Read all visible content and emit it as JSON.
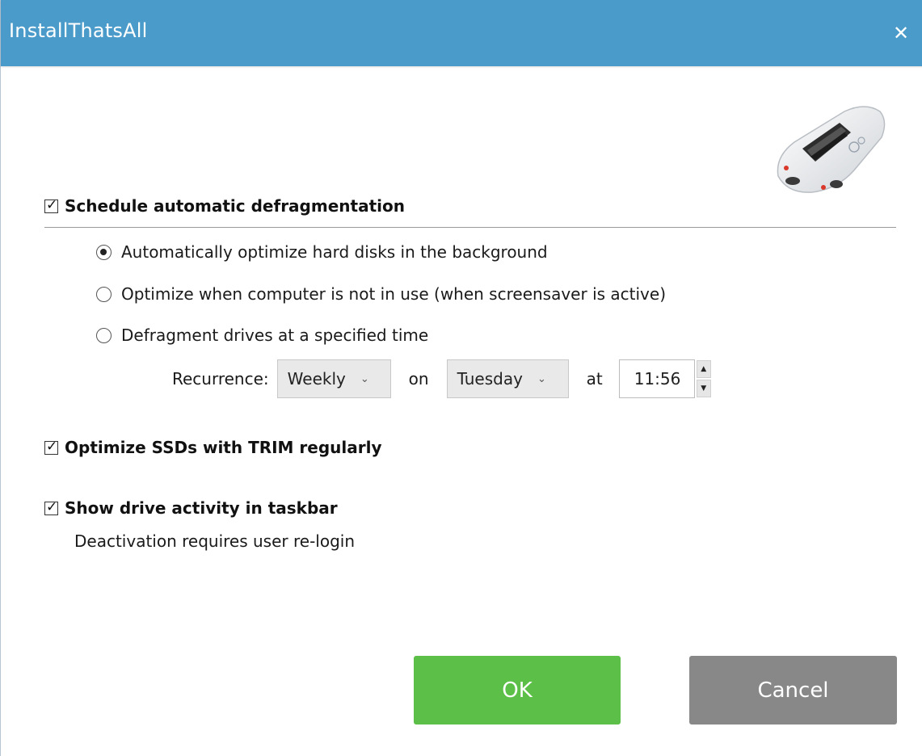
{
  "window": {
    "title": "InstallThatsAll",
    "close_glyph": "✕"
  },
  "colors": {
    "titlebar": "#4a9bc9",
    "ok": "#5cbf47",
    "cancel": "#888888"
  },
  "schedule": {
    "label": "Schedule automatic defragmentation",
    "checked": true,
    "options": [
      {
        "label": "Automatically optimize hard disks in the background",
        "selected": true
      },
      {
        "label": "Optimize when computer is not in use (when screensaver is active)",
        "selected": false
      },
      {
        "label": "Defragment drives at a specified time",
        "selected": false
      }
    ],
    "recurrence_label": "Recurrence:",
    "recurrence_value": "Weekly",
    "on_label": "on",
    "day_value": "Tuesday",
    "at_label": "at",
    "time_value": "11:56"
  },
  "ssd": {
    "label": "Optimize SSDs with TRIM regularly",
    "checked": true
  },
  "taskbar": {
    "label": "Show drive activity in taskbar",
    "checked": true,
    "note": "Deactivation requires user re-login"
  },
  "buttons": {
    "ok": "OK",
    "cancel": "Cancel"
  },
  "icons": {
    "check": "✓",
    "chevron": "⌄",
    "spin_up": "▲",
    "spin_down": "▼",
    "logo": "car-logo"
  }
}
